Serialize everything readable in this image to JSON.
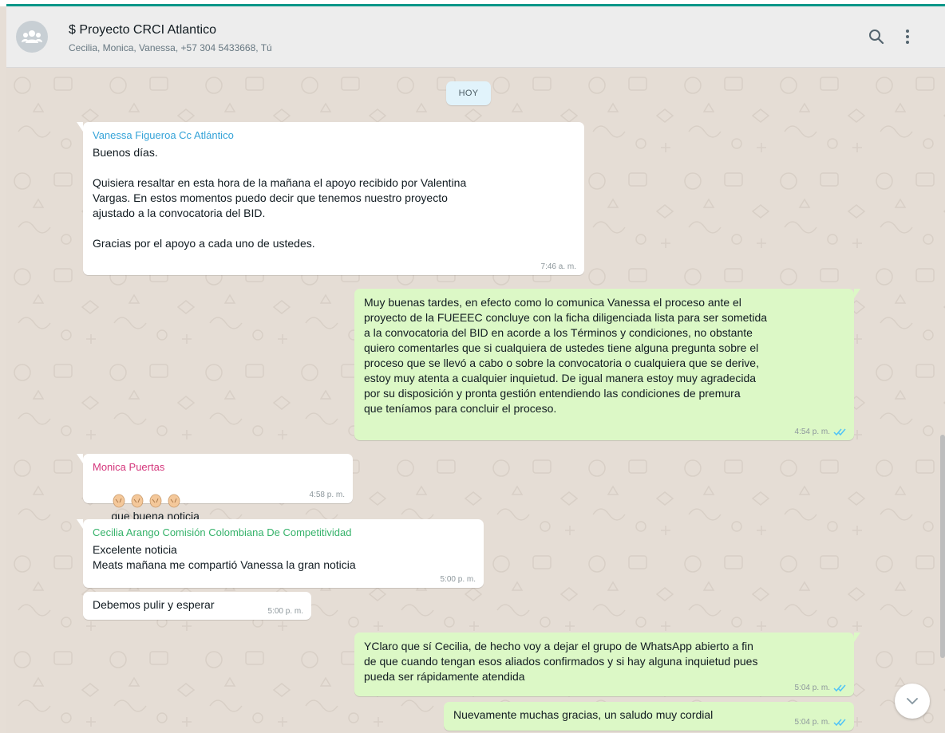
{
  "header": {
    "title": "$ Proyecto CRCI Atlantico",
    "subtitle": "Cecilia, Monica, Vanessa, +57 304 5433668, Tú",
    "avatar_icon": "group-avatar-icon",
    "search_icon": "search-icon",
    "menu_icon": "more-vert-icon"
  },
  "colors": {
    "accent": "#009688",
    "incoming_bubble": "#ffffff",
    "outgoing_bubble": "#dcf8c6",
    "sender_vanessa": "#35a3d8",
    "sender_monica": "#d4357b",
    "sender_cecilia": "#35b26a",
    "read_ticks": "#4fc3f7"
  },
  "chat": {
    "date_chip": "HOY",
    "messages": [
      {
        "sender": "Vanessa Figueroa Cc Atlántico",
        "text": "Buenos días.\n\nQuisiera resaltar en esta hora de la mañana el apoyo recibido por Valentina\nVargas. En estos momentos puedo decir que tenemos nuestro proyecto\najustado a la convocatoria del BID.\n\nGracias por el apoyo a cada uno de ustedes.",
        "time": "7:46 a. m."
      },
      {
        "sender": "",
        "text": "Muy buenas tardes, en efecto como lo comunica Vanessa el proceso ante el\nproyecto de la FUEEEC concluye con la ficha diligenciada lista para ser sometida\na la convocatoria del BID en acorde a los Términos y condiciones, no obstante\nquiero comentarles que si cualquiera de ustedes tiene alguna pregunta sobre el\nproceso que se llevó a cabo o sobre la convocatoria o cualquiera que se derive,\nestoy muy atenta a cualquier inquietud. De igual manera estoy muy agradecida\npor su disposición y pronta gestión entendiendo las condiciones de premura\nque teníamos para concluir el proceso.",
        "time": "4:54 p. m."
      },
      {
        "sender": "Monica Puertas",
        "text": "que buena noticia",
        "time": "4:58 p. m."
      },
      {
        "sender": "Cecilia Arango Comisión Colombiana De Competitividad",
        "text": "Excelente noticia\nMeats mañana me compartió Vanessa la gran noticia",
        "time": "5:00 p. m."
      },
      {
        "sender": "",
        "text": "Debemos pulir y esperar",
        "time": "5:00 p. m."
      },
      {
        "sender": "",
        "text": "YClaro que sí Cecilia, de hecho voy a dejar el grupo de WhatsApp abierto a fin\nde que cuando tengan esos aliados confirmados y si hay alguna inquietud pues\npueda ser rápidamente atendida",
        "time": "5:04 p. m."
      },
      {
        "sender": "",
        "text": "Nuevamente muchas gracias, un saludo muy cordial",
        "time": "5:04 p. m."
      }
    ]
  },
  "icons": {
    "clap": "clapping-hands-icon",
    "ticks": "double-check-icon",
    "scroll_down": "chevron-down-icon"
  }
}
